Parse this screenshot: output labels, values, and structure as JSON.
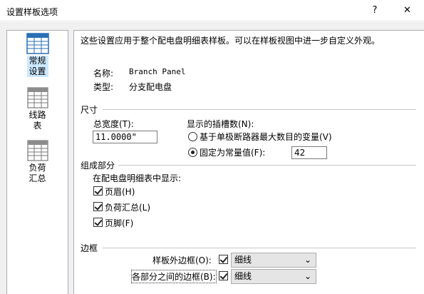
{
  "window": {
    "title": "设置样板选项",
    "help": "?",
    "close": "✕"
  },
  "nav": {
    "items": [
      {
        "label": "常规设置",
        "icon": "table-icon"
      },
      {
        "label": "线路表",
        "icon": "table-icon"
      },
      {
        "label": "负荷汇总",
        "icon": "table-icon"
      }
    ]
  },
  "intro": "这些设置应用于整个配电盘明细表样板。可以在样板视图中进一步自定义外观。",
  "info": {
    "name_label": "名称:",
    "name_value": "Branch Panel",
    "type_label": "类型:",
    "type_value": "分支配电盘"
  },
  "size": {
    "title": "尺寸",
    "total_width_label": "总宽度(T):",
    "total_width_value": "11.0000\"",
    "slots_label": "显示的插槽数(N):",
    "radio1_label": "基于单极断路器最大数目的变量(V)",
    "radio2_label": "固定为常量值(F):",
    "radio2_value": "42"
  },
  "components": {
    "title": "组成部分",
    "show_label": "在配电盘明细表中显示:",
    "header_label": "页眉(H)",
    "load_summary_label": "负荷汇总(L)",
    "footer_label": "页脚(F)"
  },
  "borders": {
    "title": "边框",
    "outer_label": "样板外边框(O):",
    "outer_value": "细线",
    "between_label": "各部分之间的边框(B):",
    "between_value": "细线"
  }
}
